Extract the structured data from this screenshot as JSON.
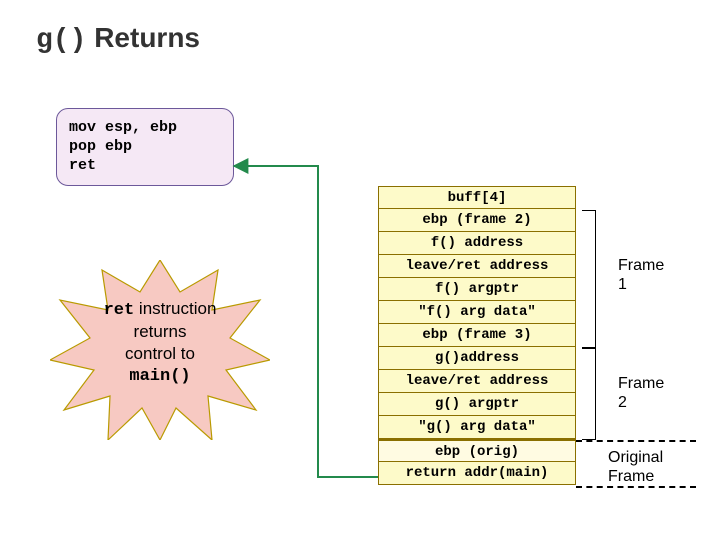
{
  "title": {
    "code": "g()",
    "rest": " Returns"
  },
  "asm": "mov esp, ebp\npop ebp\nret",
  "burst": {
    "line1_mono": "ret",
    "line1_rest": " instruction",
    "line2": "returns",
    "line3": "control to",
    "line4_mono": "main()"
  },
  "stack_rows": [
    "buff[4]",
    "ebp (frame 2)",
    "f() address",
    "leave/ret address",
    "f() argptr",
    "\"f() arg data\"",
    "ebp (frame 3)",
    "g()address",
    "leave/ret address",
    "g() argptr",
    "\"g() arg data\"",
    "ebp (orig)",
    "return addr(main)"
  ],
  "frame_labels": {
    "f1": "Frame\n1",
    "f2": "Frame\n2",
    "orig": "Original\nFrame"
  },
  "colors": {
    "accent_connector": "#238a4c",
    "burst_fill": "#f7c9c2",
    "burst_stroke": "#b99a00"
  }
}
